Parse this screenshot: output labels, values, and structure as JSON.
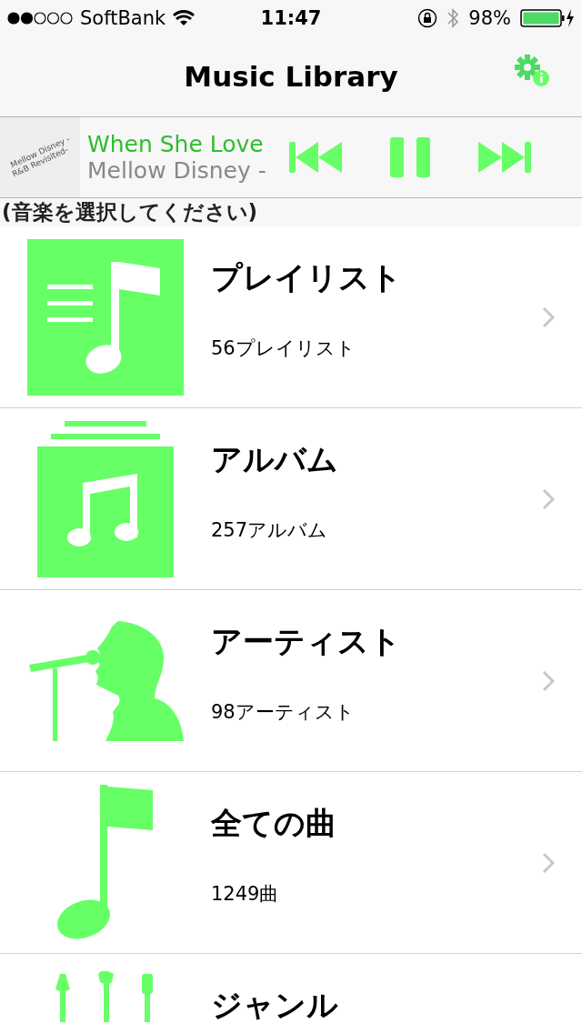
{
  "status_bar": {
    "carrier": "SoftBank",
    "time": "11:47",
    "battery": "98%"
  },
  "nav": {
    "title": "Music Library"
  },
  "now_playing": {
    "art_lines": [
      "Mellow Disney -",
      "R&B Revisited-"
    ],
    "title": "When She Love",
    "artist": "Mellow Disney -",
    "playing": true
  },
  "prompt": "(音楽を選択してください)",
  "categories": [
    {
      "kind": "playlist",
      "title": "プレイリスト",
      "count": "56プレイリスト"
    },
    {
      "kind": "album",
      "title": "アルバム",
      "count": "257アルバム"
    },
    {
      "kind": "artist",
      "title": "アーティスト",
      "count": "98アーティスト"
    },
    {
      "kind": "songs",
      "title": "全ての曲",
      "count": "1249曲"
    },
    {
      "kind": "genre",
      "title": "ジャンル"
    }
  ]
}
